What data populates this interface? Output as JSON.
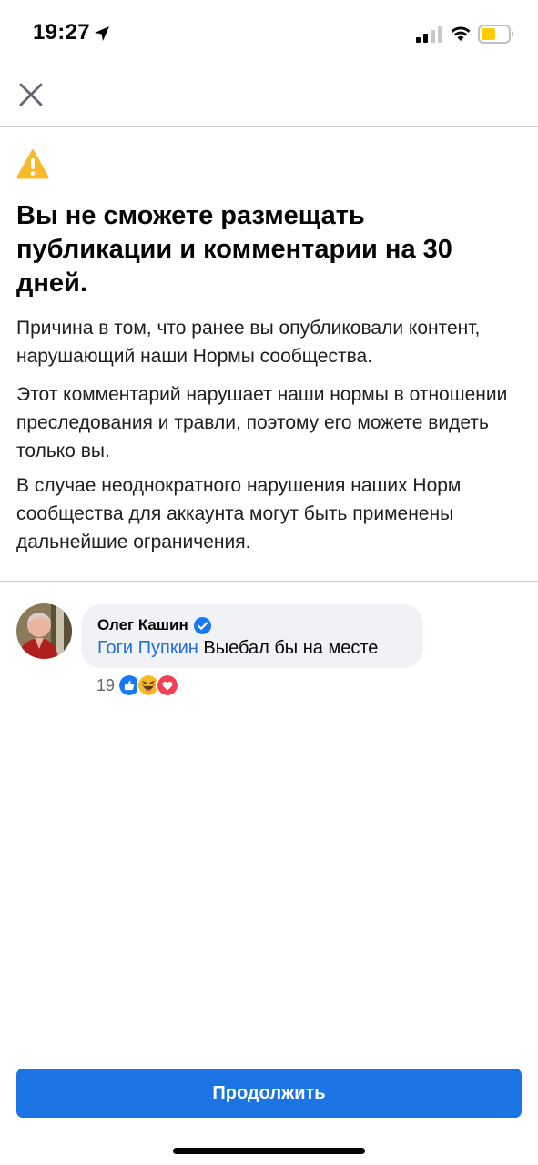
{
  "status_bar": {
    "time": "19:27",
    "icons": [
      "location-arrow-icon",
      "cellular-signal-icon",
      "wifi-icon",
      "battery-icon"
    ],
    "battery_color": "#ffcc00"
  },
  "header": {
    "close_icon": "close-icon"
  },
  "warning": {
    "icon": "warning-triangle-icon",
    "icon_color": "#f7b928",
    "headline": "Вы не сможете размещать публикации и комментарии на 30 дней.",
    "paragraphs": [
      "Причина в том, что ранее вы опубликовали контент, нарушающий наши Нормы сообщества.",
      "Этот комментарий нарушает наши нормы в отношении преследования и травли, поэтому его можете видеть только вы.",
      "В случае неоднократного нарушения наших Норм сообщества для аккаунта могут быть применены дальнейшие ограничения."
    ]
  },
  "comment": {
    "author": "Олег Кашин",
    "verified": true,
    "mention": "Гоги Пупкин",
    "text": " Выебал бы на месте",
    "reaction_count": "19",
    "reactions": [
      "like-icon",
      "haha-icon",
      "love-icon"
    ]
  },
  "footer": {
    "continue_label": "Продолжить",
    "button_color": "#1b74e4"
  }
}
